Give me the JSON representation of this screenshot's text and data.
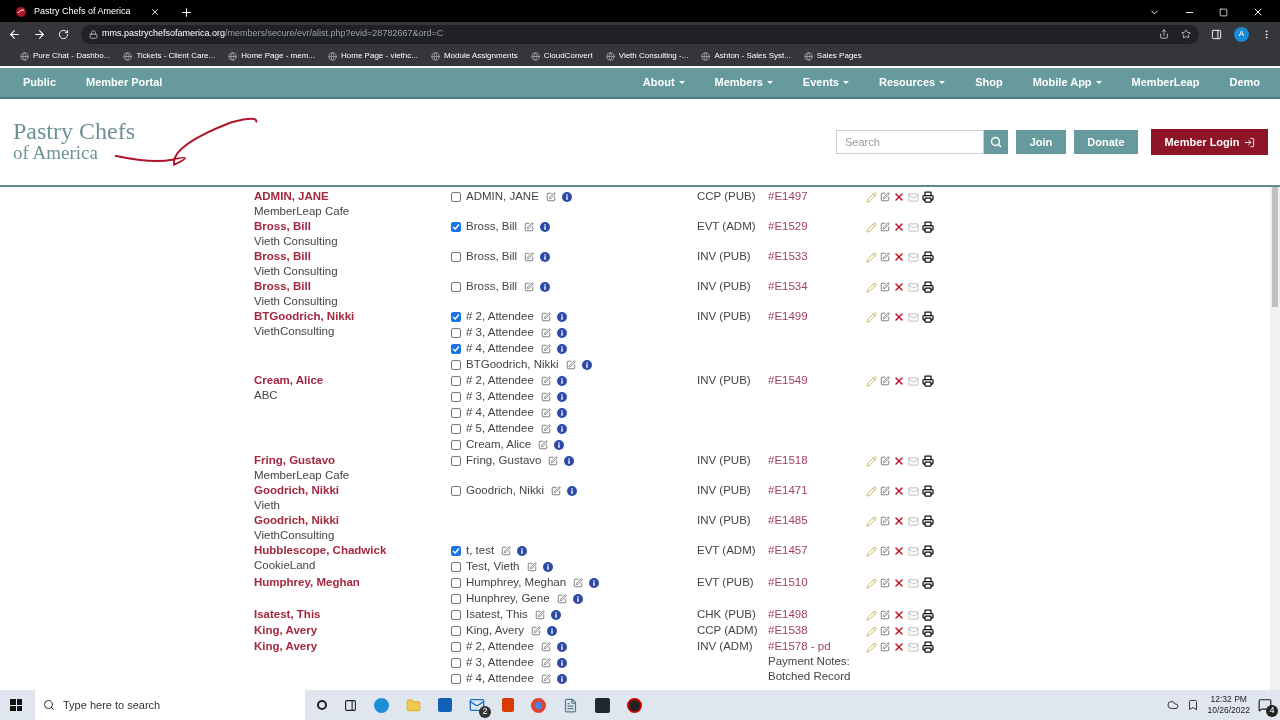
{
  "browser": {
    "tab_title": "Pastry Chefs of America",
    "url_host": "mms.pastrychefsofamerica.org",
    "url_path": "/members/secure/evr/alist.php?evid=28782667&ord=C",
    "profile_initial": "A",
    "bookmarks": [
      "Pure Chat - Dashbo...",
      "Tickets - Client Care...",
      "Home Page - mem...",
      "Home Page - viethc...",
      "Module Assignments",
      "CloudConvert",
      "Vieth Consulting -...",
      "Ashton - Sales Syst...",
      "Sales Pages"
    ]
  },
  "nav": {
    "left": [
      {
        "label": "Public"
      },
      {
        "label": "Member Portal"
      }
    ],
    "right": [
      {
        "label": "About",
        "dropdown": true
      },
      {
        "label": "Members",
        "dropdown": true
      },
      {
        "label": "Events",
        "dropdown": true
      },
      {
        "label": "Resources",
        "dropdown": true
      },
      {
        "label": "Shop",
        "dropdown": false
      },
      {
        "label": "Mobile App",
        "dropdown": true
      },
      {
        "label": "MemberLeap",
        "dropdown": false
      },
      {
        "label": "Demo",
        "dropdown": false
      }
    ]
  },
  "header": {
    "logo_line_1": "Pastry Chefs",
    "logo_line_2": "of America",
    "search_placeholder": "Search",
    "join": "Join",
    "donate": "Donate",
    "login": "Member Login"
  },
  "rows": [
    {
      "name": "ADMIN, JANE",
      "company": "MemberLeap Cafe",
      "attendees": [
        {
          "label": "ADMIN, JANE",
          "checked": false
        }
      ],
      "type": "CCP (PUB)",
      "invoice": "#E1497"
    },
    {
      "name": "Bross, Bill",
      "company": "Vieth Consulting",
      "attendees": [
        {
          "label": "Bross, Bill",
          "checked": true
        }
      ],
      "type": "EVT (ADM)",
      "invoice": "#E1529"
    },
    {
      "name": "Bross, Bill",
      "company": "Vieth Consulting",
      "attendees": [
        {
          "label": "Bross, Bill",
          "checked": false
        }
      ],
      "type": "INV (PUB)",
      "invoice": "#E1533"
    },
    {
      "name": "Bross, Bill",
      "company": "Vieth Consulting",
      "attendees": [
        {
          "label": "Bross, Bill",
          "checked": false
        }
      ],
      "type": "INV (PUB)",
      "invoice": "#E1534"
    },
    {
      "name": "BTGoodrich, Nikki",
      "company": "ViethConsulting",
      "attendees": [
        {
          "label": "# 2, Attendee",
          "checked": true
        },
        {
          "label": "# 3, Attendee",
          "checked": false
        },
        {
          "label": "# 4, Attendee",
          "checked": true
        },
        {
          "label": "BTGoodrich, Nikki",
          "checked": false
        }
      ],
      "type": "INV (PUB)",
      "invoice": "#E1499"
    },
    {
      "name": "Cream, Alice",
      "company": "ABC",
      "attendees": [
        {
          "label": "# 2, Attendee",
          "checked": false
        },
        {
          "label": "# 3, Attendee",
          "checked": false
        },
        {
          "label": "# 4, Attendee",
          "checked": false
        },
        {
          "label": "# 5, Attendee",
          "checked": false
        },
        {
          "label": "Cream, Alice",
          "checked": false
        }
      ],
      "type": "INV (PUB)",
      "invoice": "#E1549"
    },
    {
      "name": "Fring, Gustavo",
      "company": "MemberLeap Cafe",
      "attendees": [
        {
          "label": "Fring, Gustavo",
          "checked": false
        }
      ],
      "type": "INV (PUB)",
      "invoice": "#E1518"
    },
    {
      "name": "Goodrich, Nikki",
      "company": "Vieth",
      "attendees": [
        {
          "label": "Goodrich, Nikki",
          "checked": false
        }
      ],
      "type": "INV (PUB)",
      "invoice": "#E1471"
    },
    {
      "name": "Goodrich, Nikki",
      "company": "ViethConsulting",
      "attendees": [],
      "type": "INV (PUB)",
      "invoice": "#E1485"
    },
    {
      "name": "Hubblescope, Chadwick",
      "company": "CookieLand",
      "attendees": [
        {
          "label": "t, test",
          "checked": true
        },
        {
          "label": "Test, Vieth",
          "checked": false
        }
      ],
      "type": "EVT (ADM)",
      "invoice": "#E1457"
    },
    {
      "name": "Humphrey, Meghan",
      "attendees": [
        {
          "label": "Humphrey, Meghan",
          "checked": false
        },
        {
          "label": "Hunphrey, Gene",
          "checked": false
        }
      ],
      "type": "EVT (PUB)",
      "invoice": "#E1510"
    },
    {
      "name": "Isatest, This",
      "attendees": [
        {
          "label": "Isatest, This",
          "checked": false
        }
      ],
      "type": "CHK (PUB)",
      "invoice": "#E1498"
    },
    {
      "name": "King, Avery",
      "attendees": [
        {
          "label": "King, Avery",
          "checked": false
        }
      ],
      "type": "CCP (ADM)",
      "invoice": "#E1538"
    },
    {
      "name": "King, Avery",
      "attendees": [
        {
          "label": "# 2, Attendee",
          "checked": false
        },
        {
          "label": "# 3, Attendee",
          "checked": false
        },
        {
          "label": "# 4, Attendee",
          "checked": false
        }
      ],
      "type": "INV (ADM)",
      "invoice": "#E1578 - pd",
      "notes": [
        "Payment Notes:",
        "Botched Record"
      ]
    }
  ],
  "taskbar": {
    "search_placeholder": "Type here to search",
    "mail_badge": "2",
    "time": "12:32 PM",
    "date": "10/26/2022",
    "notifications": "4"
  }
}
